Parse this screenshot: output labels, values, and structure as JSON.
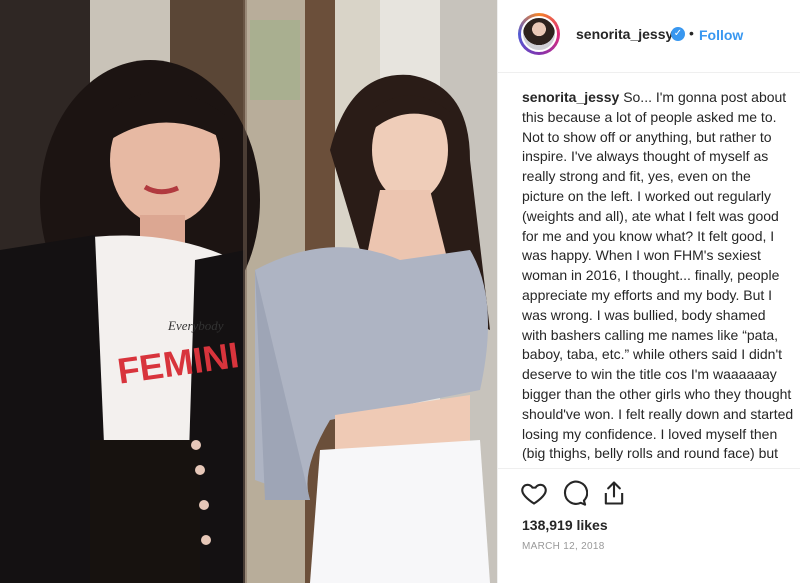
{
  "post": {
    "username": "senorita_jessy",
    "follow_label": "Follow",
    "separator": "•",
    "verified_glyph": "✓",
    "caption_user": "senorita_jessy",
    "caption_text": "So... I'm gonna post about this because a lot of people asked me to. Not to show off or anything, but rather to inspire. I've always thought of myself as really strong and fit, yes, even on the picture on the left. I worked out regularly (weights and all), ate what I felt was good for me and you know what? It felt good, I was happy. When I won FHM's sexiest woman in 2016, I thought... finally, people appreciate my efforts and my body. But I was wrong. I was bullied, body shamed with bashers calling me names like “pata, baboy, taba, etc.” while others said I didn't deserve to win the title cos I'm waaaaaay bigger than the other girls who they thought should've won. I felt really down and started losing my confidence. I loved myself then (big thighs, belly rolls and round face) but when people started pointing out my flaws, I started letting",
    "likes": "138,919 likes",
    "date": "March 12, 2018"
  },
  "photo": {
    "shirt_text_small": "Everybody",
    "shirt_text_big": "FEMINI"
  },
  "icons": {
    "like": "heart-icon",
    "comment": "comment-icon",
    "share": "share-icon"
  },
  "colors": {
    "link": "#3897f0",
    "text": "#262626",
    "muted": "#999999",
    "border": "#efefef"
  }
}
